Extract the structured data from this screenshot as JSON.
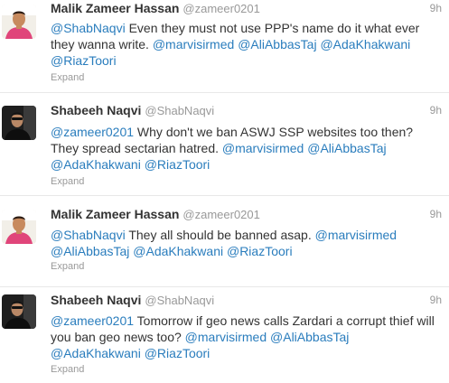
{
  "tweets": [
    {
      "fullname": "Malik Zameer Hassan",
      "screen_name": "@zameer0201",
      "time": "9h",
      "text_parts": [
        "@ShabNaqvi",
        " Even they must not use PPP's name do it what ever they wanna write. ",
        "@marvisirmed",
        " ",
        "@AliAbbasTaj",
        " ",
        "@AdaKhakwani",
        " ",
        "@RiazToori"
      ],
      "expand": "Expand",
      "avatar_icon": "user-avatar-pink-shirt"
    },
    {
      "fullname": "Shabeeh Naqvi",
      "screen_name": "@ShabNaqvi",
      "time": "9h",
      "text_parts": [
        "@zameer0201",
        " Why don't we ban ASWJ SSP websites too then? They spread sectarian hatred. ",
        "@marvisirmed",
        " ",
        "@AliAbbasTaj",
        " ",
        "@AdaKhakwani",
        " ",
        "@RiazToori"
      ],
      "expand": "Expand",
      "avatar_icon": "user-avatar-dark-photo"
    },
    {
      "fullname": "Malik Zameer Hassan",
      "screen_name": "@zameer0201",
      "time": "9h",
      "text_parts": [
        "@ShabNaqvi",
        " They all should be banned asap. ",
        "@marvisirmed",
        " ",
        "@AliAbbasTaj",
        " ",
        "@AdaKhakwani",
        " ",
        "@RiazToori"
      ],
      "expand": "Expand",
      "avatar_icon": "user-avatar-pink-shirt"
    },
    {
      "fullname": "Shabeeh Naqvi",
      "screen_name": "@ShabNaqvi",
      "time": "9h",
      "text_parts": [
        "@zameer0201",
        " Tomorrow if geo news calls Zardari a corrupt thief will you ban geo news too? ",
        "@marvisirmed",
        " ",
        "@AliAbbasTaj",
        " ",
        "@AdaKhakwani",
        " ",
        "@RiazToori"
      ],
      "expand": "Expand",
      "avatar_icon": "user-avatar-dark-photo"
    }
  ],
  "colors": {
    "link": "#2a7dbd",
    "name": "#333333",
    "muted": "#999999",
    "divider": "#e8e8e8"
  }
}
